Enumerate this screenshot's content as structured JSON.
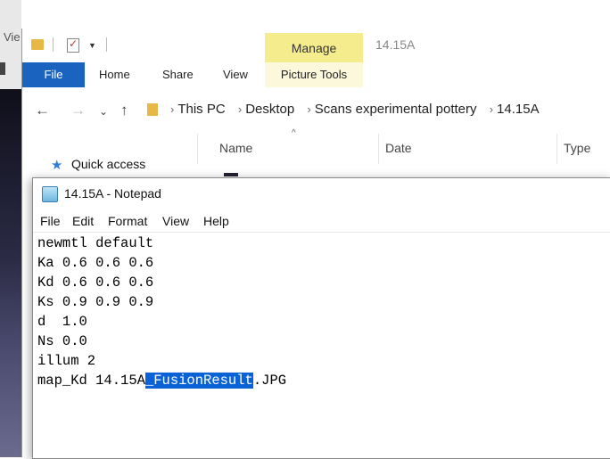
{
  "background": {
    "left_text": "Vie"
  },
  "explorer": {
    "window_title": "14.15A",
    "manage_tab": "Manage",
    "ribbon_tabs": [
      "File",
      "Home",
      "Share",
      "View",
      "Picture Tools"
    ],
    "breadcrumbs": [
      "This PC",
      "Desktop",
      "Scans experimental pottery",
      "14.15A"
    ],
    "columns": [
      "Name",
      "Date",
      "Type"
    ],
    "sidebar": {
      "quick_access": "Quick access"
    }
  },
  "notepad": {
    "title": "14.15A - Notepad",
    "menu": [
      "File",
      "Edit",
      "Format",
      "View",
      "Help"
    ],
    "lines": [
      "newmtl default",
      "Ka 0.6 0.6 0.6",
      "Kd 0.6 0.6 0.6",
      "Ks 0.9 0.9 0.9",
      "d  1.0",
      "Ns 0.0",
      "illum 2"
    ],
    "last_line": {
      "before": "map_Kd 14.15A",
      "selected": "_FusionResult",
      "after": ".JPG"
    },
    "selection_color": "#0a63d6"
  }
}
